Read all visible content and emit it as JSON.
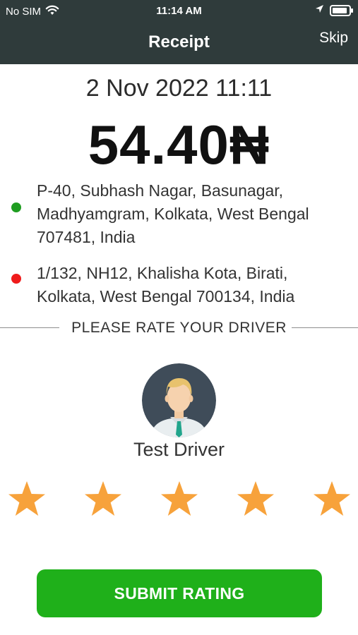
{
  "status_bar": {
    "carrier": "No SIM",
    "time": "11:14 AM"
  },
  "nav": {
    "title": "Receipt",
    "skip_label": "Skip"
  },
  "receipt": {
    "datetime": "2 Nov 2022 11:11",
    "amount": "54.40₦",
    "pickup_lines": [
      "P-40, Subhash Nagar, Basunagar,",
      "Madhyamgram, Kolkata, West Bengal",
      "707481, India"
    ],
    "dropoff_lines": [
      "1/132, NH12, Khalisha Kota, Birati,",
      "Kolkata, West Bengal 700134, India"
    ]
  },
  "rating": {
    "prompt": "PLEASE RATE YOUR DRIVER",
    "driver_name": "Test Driver",
    "star_count": 5,
    "stars_selected": 5,
    "submit_label": "SUBMIT RATING"
  },
  "colors": {
    "header_bg": "#2f3b3b",
    "pickup_dot": "#1f9d21",
    "dropoff_dot": "#ef1b1b",
    "star": "#f7a23b",
    "submit_bg": "#1fb01a"
  },
  "icons": {
    "wifi": "wifi-icon",
    "location_arrow": "location-arrow-icon",
    "battery": "battery-icon",
    "avatar": "driver-avatar-icon",
    "star": "star-icon"
  }
}
